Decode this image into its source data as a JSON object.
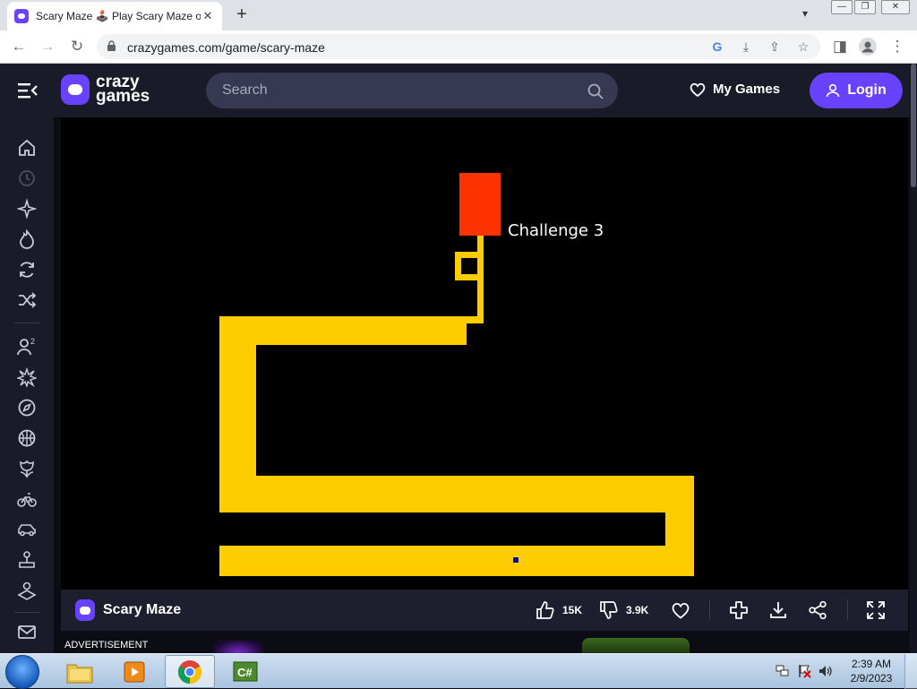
{
  "browser": {
    "tab_title": "Scary Maze 🕹️ Play Scary Maze on CrazyGames",
    "url": "crazygames.com/game/scary-maze"
  },
  "site": {
    "logo_line1": "crazy",
    "logo_line2": "games",
    "search_placeholder": "Search",
    "my_games_label": "My Games",
    "login_label": "Login",
    "brand_color": "#6842ff"
  },
  "sidebar": {
    "icons": [
      "home-icon",
      "recent-icon",
      "new-icon",
      "trending-icon",
      "updated-icon",
      "random-icon",
      "multiplayer-icon",
      "action-icon",
      "adventure-icon",
      "basketball-icon",
      "flower-icon",
      "bike-icon",
      "car-icon",
      "joystick-icon",
      "arcade-icon",
      "mail-icon"
    ]
  },
  "game": {
    "challenge_label": "Challenge 3",
    "maze_color": "#ffcc00",
    "goal_color": "#ff3300",
    "background_color": "#000000"
  },
  "gamebar": {
    "title": "Scary Maze",
    "likes": "15K",
    "dislikes": "3.9K"
  },
  "ad": {
    "label": "ADVERTISEMENT"
  },
  "taskbar": {
    "time": "2:39 AM",
    "date": "2/9/2023"
  }
}
